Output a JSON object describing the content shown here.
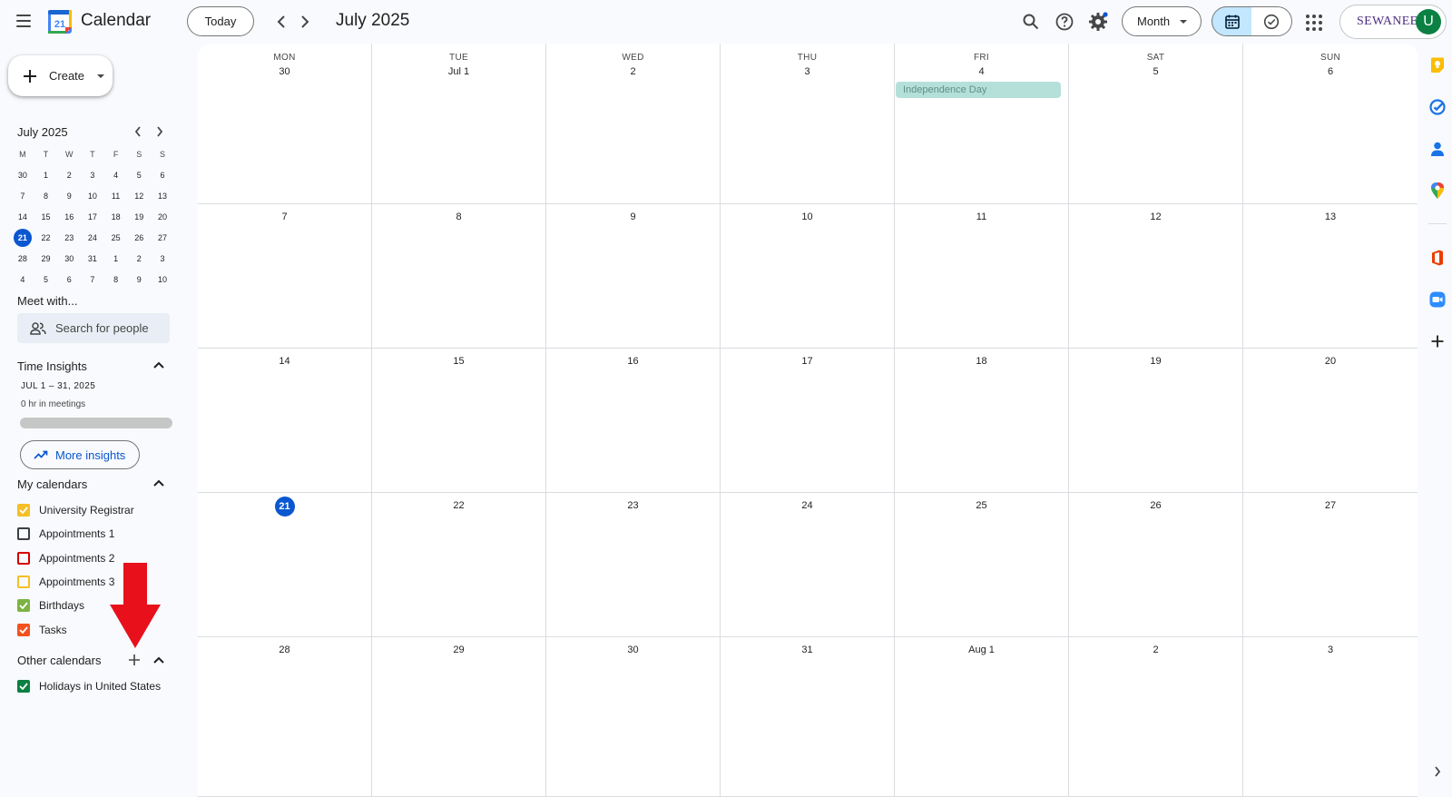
{
  "header": {
    "app_title": "Calendar",
    "logo_day": "21",
    "today_label": "Today",
    "month_title": "July 2025",
    "view_label": "Month",
    "account_brand": "SEWANEE",
    "avatar_initial": "U"
  },
  "sidebar": {
    "create_label": "Create",
    "mini_calendar": {
      "title": "July 2025",
      "weekdays": [
        "M",
        "T",
        "W",
        "T",
        "F",
        "S",
        "S"
      ],
      "weeks": [
        [
          "30",
          "1",
          "2",
          "3",
          "4",
          "5",
          "6"
        ],
        [
          "7",
          "8",
          "9",
          "10",
          "11",
          "12",
          "13"
        ],
        [
          "14",
          "15",
          "16",
          "17",
          "18",
          "19",
          "20"
        ],
        [
          "21",
          "22",
          "23",
          "24",
          "25",
          "26",
          "27"
        ],
        [
          "28",
          "29",
          "30",
          "31",
          "1",
          "2",
          "3"
        ],
        [
          "4",
          "5",
          "6",
          "7",
          "8",
          "9",
          "10"
        ]
      ],
      "today": "21"
    },
    "meet_with_title": "Meet with...",
    "search_people_placeholder": "Search for people",
    "time_insights": {
      "title": "Time Insights",
      "range": "JUL 1 – 31, 2025",
      "meetings": "0 hr in meetings",
      "more_label": "More insights"
    },
    "my_calendars": {
      "title": "My calendars",
      "items": [
        {
          "label": "University Registrar",
          "color": "#f6bf26",
          "checked": true
        },
        {
          "label": "Appointments 1",
          "color": "#3c4043",
          "checked": false
        },
        {
          "label": "Appointments 2",
          "color": "#d50000",
          "checked": false
        },
        {
          "label": "Appointments 3",
          "color": "#f6bf26",
          "checked": false
        },
        {
          "label": "Birthdays",
          "color": "#7cb342",
          "checked": true
        },
        {
          "label": "Tasks",
          "color": "#f4511e",
          "checked": true
        }
      ]
    },
    "other_calendars": {
      "title": "Other calendars",
      "items": [
        {
          "label": "Holidays in United States",
          "color": "#0b8043",
          "checked": true
        }
      ]
    }
  },
  "month_view": {
    "weekdays": [
      "MON",
      "TUE",
      "WED",
      "THU",
      "FRI",
      "SAT",
      "SUN"
    ],
    "weeks": [
      [
        "30",
        "Jul 1",
        "2",
        "3",
        "4",
        "5",
        "6"
      ],
      [
        "7",
        "8",
        "9",
        "10",
        "11",
        "12",
        "13"
      ],
      [
        "14",
        "15",
        "16",
        "17",
        "18",
        "19",
        "20"
      ],
      [
        "21",
        "22",
        "23",
        "24",
        "25",
        "26",
        "27"
      ],
      [
        "28",
        "29",
        "30",
        "31",
        "Aug 1",
        "2",
        "3"
      ]
    ],
    "today": "21",
    "events": [
      {
        "label": "Independence Day",
        "week": 0,
        "day": 4,
        "color": "#b5e0da"
      }
    ]
  },
  "colors": {
    "accent": "#0b57d0",
    "selected_view": "#c2e7ff",
    "annotation_arrow": "#e8101a"
  }
}
